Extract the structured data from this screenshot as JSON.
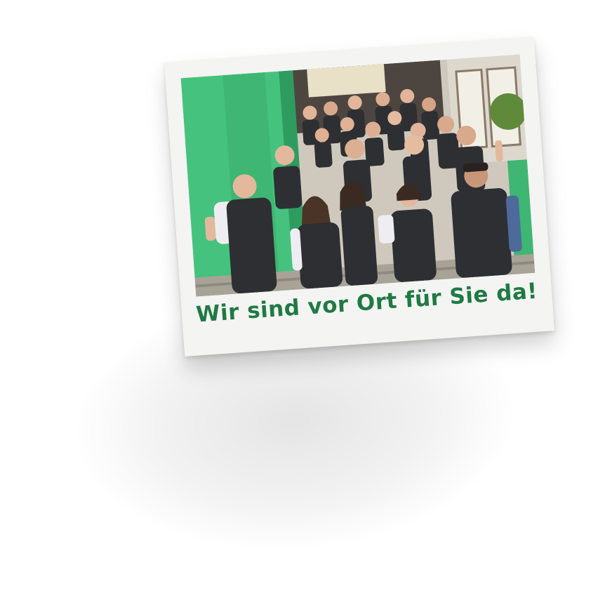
{
  "polaroid": {
    "caption": "Wir sind vor Ort für Sie da!",
    "caption_color": "#1f7a43"
  },
  "photo": {
    "wall_color": "#45c37e",
    "vest_color": "#2d2f33"
  }
}
